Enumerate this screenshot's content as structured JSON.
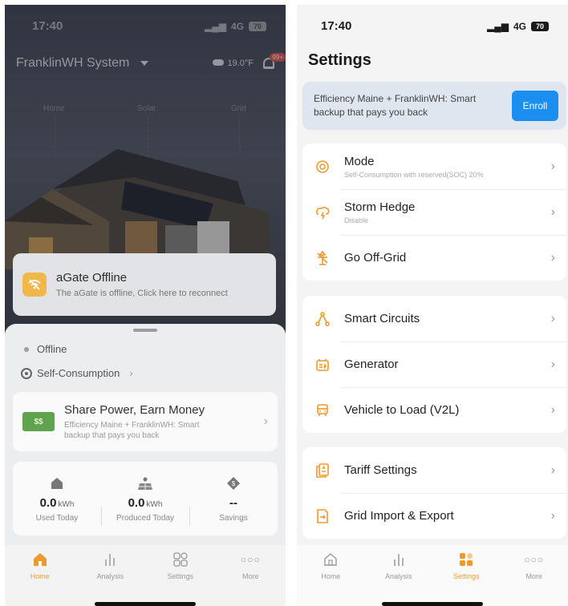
{
  "left": {
    "status": {
      "time": "17:40",
      "network": "4G",
      "battery": "70"
    },
    "header": {
      "system_name": "FranklinWH System",
      "temperature": "19.0°F",
      "notification_count": "99+"
    },
    "flow_labels": [
      "Home",
      "Solar",
      "Grid"
    ],
    "offline_banner": {
      "title": "aGate Offline",
      "subtitle": "The aGate is offline, Click here to reconnect"
    },
    "sheet": {
      "status": "Offline",
      "mode": "Self-Consumption",
      "share": {
        "title": "Share Power, Earn Money",
        "subtitle": "Efficiency Maine + FranklinWH: Smart backup that pays you back"
      },
      "stats": [
        {
          "value": "0.0",
          "unit": "kWh",
          "label": "Used Today"
        },
        {
          "value": "0.0",
          "unit": "kWh",
          "label": "Produced Today"
        },
        {
          "value": "--",
          "unit": "",
          "label": "Savings"
        }
      ]
    },
    "tabs": [
      {
        "label": "Home",
        "icon": "home-icon"
      },
      {
        "label": "Analysis",
        "icon": "bar-chart-icon"
      },
      {
        "label": "Settings",
        "icon": "grid-icon"
      },
      {
        "label": "More",
        "icon": "more-icon"
      }
    ],
    "active_tab": "Home"
  },
  "right": {
    "status": {
      "time": "17:40",
      "network": "4G",
      "battery": "70"
    },
    "title": "Settings",
    "enroll": {
      "text": "Efficiency Maine + FranklinWH: Smart backup that pays you back",
      "button": "Enroll"
    },
    "groups": [
      [
        {
          "label": "Mode",
          "sub": "Self-Consumption with reserved(SOC) 20%",
          "icon": "mode-icon"
        },
        {
          "label": "Storm Hedge",
          "sub": "Disable",
          "icon": "storm-icon"
        },
        {
          "label": "Go Off-Grid",
          "sub": "",
          "icon": "off-grid-icon"
        }
      ],
      [
        {
          "label": "Smart Circuits",
          "sub": "",
          "icon": "circuits-icon"
        },
        {
          "label": "Generator",
          "sub": "",
          "icon": "generator-icon"
        },
        {
          "label": "Vehicle to Load (V2L)",
          "sub": "",
          "icon": "vehicle-icon"
        }
      ],
      [
        {
          "label": "Tariff Settings",
          "sub": "",
          "icon": "tariff-icon"
        },
        {
          "label": "Grid Import & Export",
          "sub": "",
          "icon": "grid-export-icon"
        }
      ]
    ],
    "tabs": [
      {
        "label": "Home",
        "icon": "home-icon"
      },
      {
        "label": "Analysis",
        "icon": "bar-chart-icon"
      },
      {
        "label": "Settings",
        "icon": "settings-icon"
      },
      {
        "label": "More",
        "icon": "more-icon"
      }
    ],
    "active_tab": "Settings",
    "colors": {
      "accent": "#ec9a2c",
      "enroll_button": "#1b8ff0"
    }
  }
}
